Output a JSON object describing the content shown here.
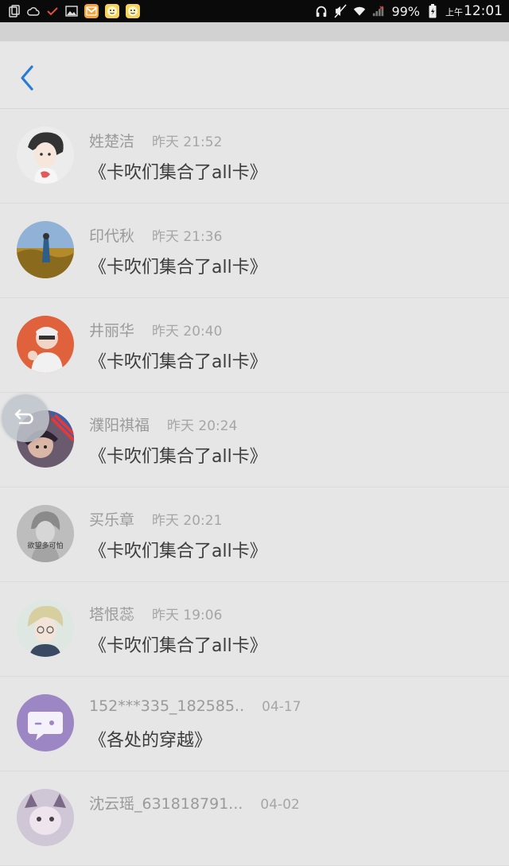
{
  "status_bar": {
    "battery": "99%",
    "time_prefix": "上午",
    "time": "12:01",
    "icons": [
      "copy-icon",
      "cloud-icon",
      "check-icon",
      "image-icon",
      "app-icon",
      "face-app-icon",
      "face-app-icon",
      "headphones-icon",
      "mute-icon",
      "wifi-icon",
      "signal-icon",
      "battery-icon"
    ]
  },
  "header": {
    "back_icon": "chevron-left-icon"
  },
  "floating_button": {
    "icon": "undo-arrow-icon"
  },
  "colors": {
    "accent": "#2a7bd4",
    "text_primary": "#3c3c3c",
    "text_secondary": "#9a9a9a",
    "background": "#e6e6e6"
  },
  "list": {
    "items": [
      {
        "name": "姓楚洁",
        "time": "昨天 21:52",
        "message": "《卡吹们集合了all卡》"
      },
      {
        "name": "印代秋",
        "time": "昨天 21:36",
        "message": "《卡吹们集合了all卡》"
      },
      {
        "name": "井丽华",
        "time": "昨天 20:40",
        "message": "《卡吹们集合了all卡》"
      },
      {
        "name": "濮阳祺福",
        "time": "昨天 20:24",
        "message": "《卡吹们集合了all卡》"
      },
      {
        "name": "买乐章",
        "time": "昨天 20:21",
        "message": "《卡吹们集合了all卡》",
        "avatar_text": "欲望多可怕"
      },
      {
        "name": "塔恨蕊",
        "time": "昨天 19:06",
        "message": "《卡吹们集合了all卡》"
      },
      {
        "name": "152***335_182585..",
        "time": "04-17",
        "message": "《各处的穿越》"
      },
      {
        "name": "沈云瑶_631818791...",
        "time": "04-02",
        "message": ""
      }
    ]
  }
}
